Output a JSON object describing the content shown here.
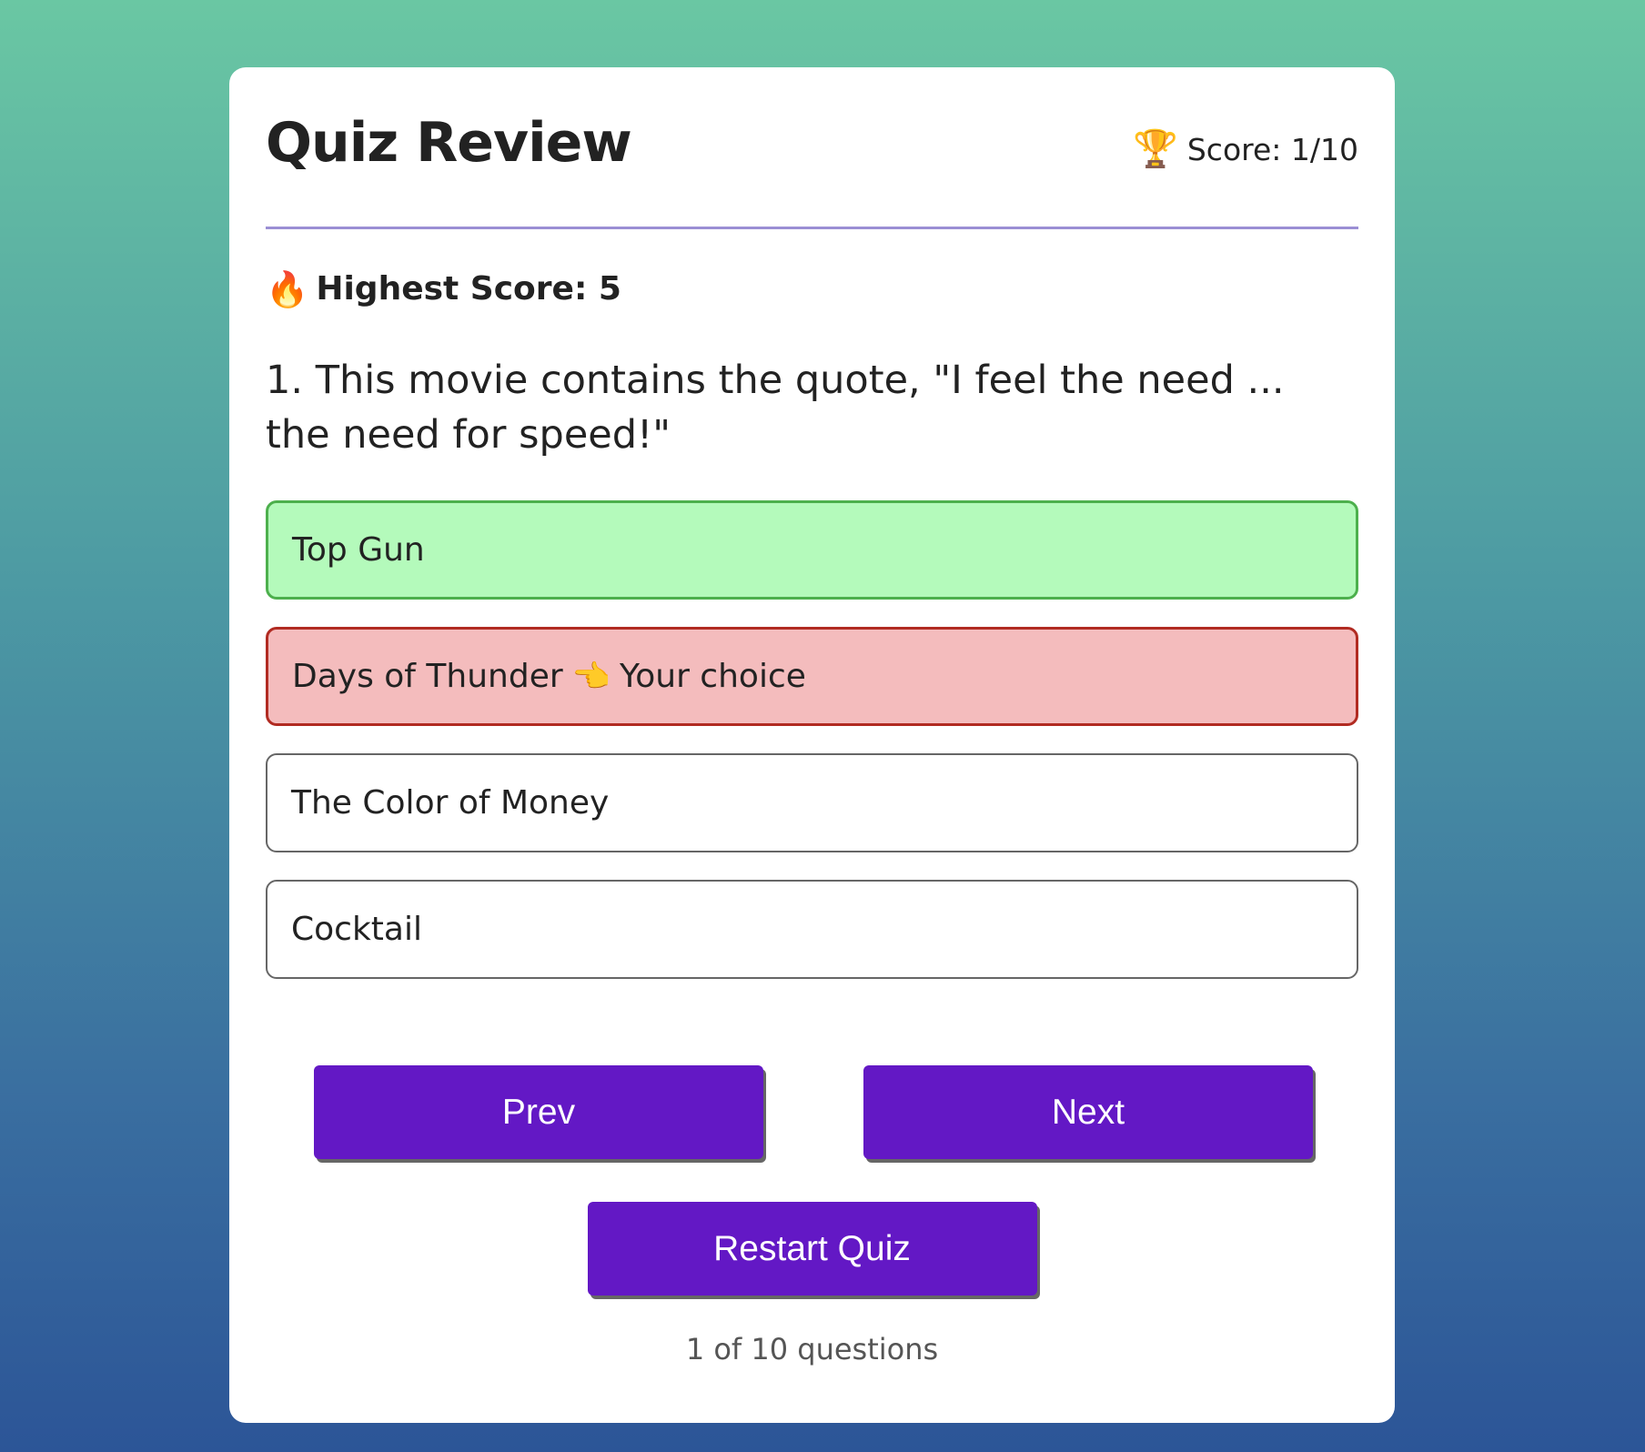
{
  "header": {
    "title": "Quiz Review",
    "score_icon": "trophy-icon",
    "score_label": "Score: 1/10"
  },
  "highest": {
    "icon": "fire-icon",
    "label": "Highest Score: 5"
  },
  "question": {
    "text": "1. This movie contains the quote, \"I feel the need ... the need for speed!\""
  },
  "options": [
    {
      "label": "Top Gun",
      "state": "correct"
    },
    {
      "label": "Days of Thunder",
      "state": "selected-wrong",
      "pointer_icon": "pointing-hand-icon",
      "note": "Your choice"
    },
    {
      "label": "The Color of Money",
      "state": "neutral"
    },
    {
      "label": "Cocktail",
      "state": "neutral"
    }
  ],
  "buttons": {
    "prev": "Prev",
    "next": "Next",
    "restart": "Restart Quiz"
  },
  "footer": {
    "progress": "1 of 10 questions"
  },
  "colors": {
    "accent": "#6318c5",
    "correct_bg": "#b4fabb",
    "correct_border": "#4db04d",
    "wrong_bg": "#f4bcbd",
    "wrong_border": "#b12b22",
    "divider": "#9b8fd4"
  }
}
